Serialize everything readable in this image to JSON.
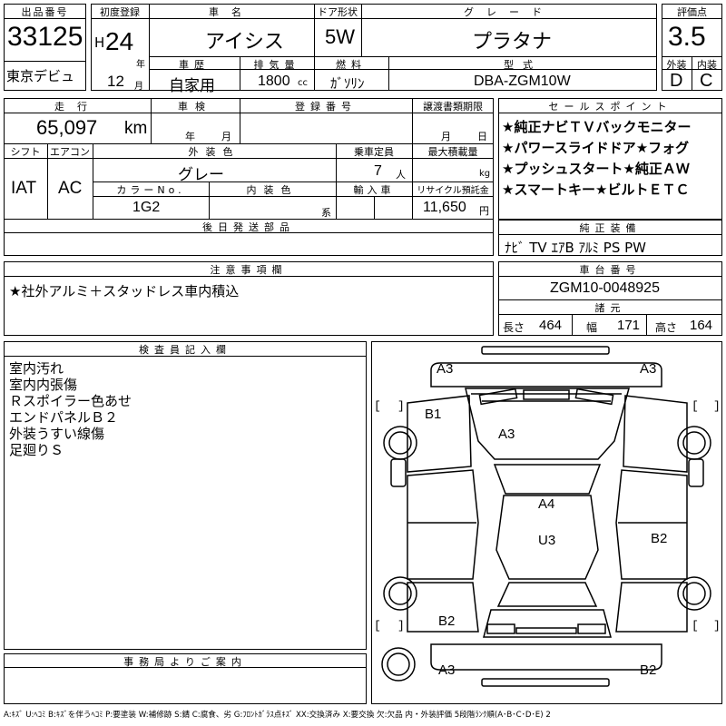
{
  "top": {
    "lot_label": "出品番号",
    "lot_no": "33125",
    "debut_label": "東京デビュ",
    "reg_label": "初度登録",
    "era": "H",
    "year": "24",
    "year_unit": "年",
    "month": "12",
    "month_unit": "月",
    "name_label": "車名",
    "name": "アイシス",
    "door_label": "ドア形状",
    "door": "5W",
    "grade_label": "グレード",
    "grade": "プラタナ",
    "score_label": "評価点",
    "score": "3.5",
    "history_label": "車歴",
    "history": "自家用",
    "disp_label": "排気量",
    "disp": "1800",
    "disp_unit": "cc",
    "fuel_label": "燃料",
    "fuel": "ｶﾞｿﾘﾝ",
    "model_label": "型式",
    "model": "DBA-ZGM10W",
    "ext_label": "外装",
    "ext": "D",
    "int_label": "内装",
    "int": "C"
  },
  "second": {
    "mileage_label": "走行",
    "mileage": "65,097",
    "mileage_unit": "km",
    "inspect_label": "車検",
    "inspect_year_unit": "年",
    "inspect_month_unit": "月",
    "regno_label": "登録番号",
    "transfer_label": "譲渡書類期限",
    "transfer_month_unit": "月",
    "transfer_day_unit": "日",
    "shift_label": "シフト",
    "shift": "IAT",
    "ac_label": "エアコン",
    "ac": "AC",
    "color_label": "外装色",
    "color": "グレー",
    "seats_label": "乗車定員",
    "seats": "7",
    "seats_unit": "人",
    "load_label": "最大積載量",
    "load_unit": "kg",
    "colorno_label": "カラーNo.",
    "colorno": "1G2",
    "intcolor_label": "内装色",
    "intcolor_unit": "系",
    "import_label": "輸入車",
    "recycle_label": "リサイクル預託金",
    "recycle": "11,650",
    "recycle_unit": "円",
    "sendlater_label": "後日発送部品"
  },
  "sales": {
    "label": "セールスポイント",
    "lines": [
      "★純正ナビＴＶバックモニター",
      "★パワースライドドア★フォグ",
      "★プッシュスタート★純正ＡＷ",
      "★スマートキー★ビルトＥＴＣ"
    ]
  },
  "equip": {
    "label": "純正装備",
    "value": "ﾅﾋﾞ TV ｴｱB ｱﾙﾐ PS PW"
  },
  "notes": {
    "label": "注意事項欄",
    "value": "★社外アルミ＋スタッドレス車内積込"
  },
  "chassis": {
    "label": "車台番号",
    "value": "ZGM10-0048925"
  },
  "dims": {
    "label": "諸元",
    "len_label": "長さ",
    "len": "464",
    "wid_label": "幅",
    "wid": "171",
    "hgt_label": "高さ",
    "hgt": "164"
  },
  "inspector": {
    "label": "検査員記入欄",
    "lines": [
      "室内汚れ",
      "室内内張傷",
      "Ｒスポイラー色あせ",
      "エンドパネルＢ２",
      "外装うすい線傷",
      "足廻りＳ"
    ]
  },
  "office": {
    "label": "事務局よりご案内"
  },
  "diagram": {
    "marks": {
      "front_left": "A3",
      "front_right": "A3",
      "b1": "B1",
      "hood": "A3",
      "roof": "A4",
      "u3": "U3",
      "right_rear": "B2",
      "left_rear": "B2",
      "rear_left": "A3",
      "rear_right": "B2"
    },
    "bracket_l": "[",
    "bracket_r": "]"
  },
  "legend": "A:ｷｽﾞ U:ﾍｺﾐ B:ｷｽﾞを伴うﾍｺﾐ P:要塗装 W:補修跡 S:錆 C:腐食、劣 G:ﾌﾛﾝﾄｶﾞﾗｽ点ｷｽﾞ XX:交換済み X:要交換 欠:欠品 内・外装評価 5段階ﾗﾝｸ順(A･B･C･D･E) 2"
}
